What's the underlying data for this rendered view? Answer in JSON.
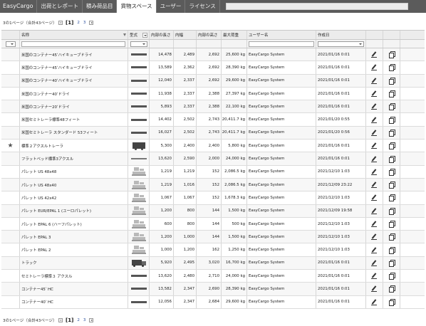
{
  "tabs": [
    {
      "label": "EasyCargo"
    },
    {
      "label": "出荷とレポート"
    },
    {
      "label": "積み荷品目"
    },
    {
      "label": "貨物スペース"
    },
    {
      "label": "ユーザー"
    },
    {
      "label": "ライセンス"
    }
  ],
  "pager": {
    "summary": "3の1ページ（合計43ページ）",
    "current": "[1]",
    "page2": "2",
    "page3": "3"
  },
  "columns": [
    "名称",
    "型式",
    "内部の長さ",
    "内幅",
    "内部の高さ",
    "最大荷重",
    "ユーザー名",
    "作成日"
  ],
  "rows": [
    {
      "name": "米国のコンテナー45ʹハイキューブドライ",
      "shape": "bar",
      "len": "14,478",
      "wid": "2,489",
      "hgt": "2,692",
      "load": "25,600 kg",
      "user": "EasyCargo System",
      "date": "2021/01/16 0:01",
      "fav": ""
    },
    {
      "name": "米国のコンテナー45ʹハイキューブドライ",
      "shape": "bar",
      "len": "13,589",
      "wid": "2,362",
      "hgt": "2,692",
      "load": "28,390 kg",
      "user": "EasyCargo System",
      "date": "2021/01/16 0:01",
      "fav": ""
    },
    {
      "name": "米国のコンテナー40ʹハイキューブドライ",
      "shape": "bar",
      "len": "12,040",
      "wid": "2,337",
      "hgt": "2,692",
      "load": "29,600 kg",
      "user": "EasyCargo System",
      "date": "2021/01/16 0:01",
      "fav": ""
    },
    {
      "name": "米国のコンテナー40ʹドライ",
      "shape": "bar",
      "len": "11,938",
      "wid": "2,337",
      "hgt": "2,388",
      "load": "27,397 kg",
      "user": "EasyCargo System",
      "date": "2021/01/16 0:01",
      "fav": ""
    },
    {
      "name": "米国のコンテナー20ʹドライ",
      "shape": "bar",
      "len": "5,893",
      "wid": "2,337",
      "hgt": "2,388",
      "load": "22,100 kg",
      "user": "EasyCargo System",
      "date": "2021/01/16 0:01",
      "fav": ""
    },
    {
      "name": "米国セミトレーラ標準48フィート",
      "shape": "bar",
      "len": "14,402",
      "wid": "2,502",
      "hgt": "2,743",
      "load": "20,411.7 kg",
      "user": "EasyCargo System",
      "date": "2021/01/20 0:55",
      "fav": ""
    },
    {
      "name": "米国セミトレーラ スタンダード 53フィート",
      "shape": "bar",
      "len": "16,027",
      "wid": "2,502",
      "hgt": "2,743",
      "load": "20,411.7 kg",
      "user": "EasyCargo System",
      "date": "2021/01/20 0:56",
      "fav": ""
    },
    {
      "name": "標準２アクスルトレーラ",
      "shape": "trailer",
      "len": "5,300",
      "wid": "2,400",
      "hgt": "2,400",
      "load": "5,800 kg",
      "user": "EasyCargo System",
      "date": "2021/01/16 0:01",
      "fav": "★"
    },
    {
      "name": "フラットベッド標準3アクスル",
      "shape": "thin",
      "len": "13,620",
      "wid": "2,590",
      "hgt": "2,000",
      "load": "24,000 kg",
      "user": "EasyCargo System",
      "date": "2021/01/16 0:01",
      "fav": ""
    },
    {
      "name": "パレット US 48x48",
      "shape": "pallet",
      "len": "1,219",
      "wid": "1,219",
      "hgt": "152",
      "load": "2,086.5 kg",
      "user": "EasyCargo System",
      "date": "2021/12/10 1:03",
      "fav": ""
    },
    {
      "name": "パレット US 48x40",
      "shape": "pallet",
      "len": "1,219",
      "wid": "1,016",
      "hgt": "152",
      "load": "2,086.5 kg",
      "user": "EasyCargo System",
      "date": "2021/12/09 23:22",
      "fav": ""
    },
    {
      "name": "パレット US 42x42",
      "shape": "pallet",
      "len": "1,067",
      "wid": "1,067",
      "hgt": "152",
      "load": "1,678.3 kg",
      "user": "EasyCargo System",
      "date": "2021/12/10 1:03",
      "fav": ""
    },
    {
      "name": "パレット EUR/EPAL 1 (ユーロパレット)",
      "shape": "pallet",
      "len": "1,200",
      "wid": "800",
      "hgt": "144",
      "load": "1,500 kg",
      "user": "EasyCargo System",
      "date": "2021/12/09 19:58",
      "fav": ""
    },
    {
      "name": "パレット EPAL 6 (ハーフパレット)",
      "shape": "pallet",
      "len": "600",
      "wid": "800",
      "hgt": "144",
      "load": "500 kg",
      "user": "EasyCargo System",
      "date": "2021/12/10 1:03",
      "fav": ""
    },
    {
      "name": "パレット EPAL 3",
      "shape": "pallet",
      "len": "1,200",
      "wid": "1,000",
      "hgt": "144",
      "load": "1,500 kg",
      "user": "EasyCargo System",
      "date": "2021/12/10 1:03",
      "fav": ""
    },
    {
      "name": "パレット EPAL 2",
      "shape": "pallet",
      "len": "1,000",
      "wid": "1,200",
      "hgt": "162",
      "load": "1,250 kg",
      "user": "EasyCargo System",
      "date": "2021/12/10 1:03",
      "fav": ""
    },
    {
      "name": "トラック",
      "shape": "truck",
      "len": "5,920",
      "wid": "2,495",
      "hgt": "3,020",
      "load": "16,700 kg",
      "user": "EasyCargo System",
      "date": "2021/01/16 0:01",
      "fav": ""
    },
    {
      "name": "セミトレーラ標準３ アクスル",
      "shape": "bar",
      "len": "13,620",
      "wid": "2,480",
      "hgt": "2,710",
      "load": "24,000 kg",
      "user": "EasyCargo System",
      "date": "2021/01/16 0:01",
      "fav": ""
    },
    {
      "name": "コンテナー45ʹ HC",
      "shape": "bar",
      "len": "13,582",
      "wid": "2,347",
      "hgt": "2,690",
      "load": "28,390 kg",
      "user": "EasyCargo System",
      "date": "2021/01/16 0:01",
      "fav": ""
    },
    {
      "name": "コンテナー40ʹ HC",
      "shape": "bar",
      "len": "12,056",
      "wid": "2,347",
      "hgt": "2,684",
      "load": "29,600 kg",
      "user": "EasyCargo System",
      "date": "2021/01/16 0:01",
      "fav": ""
    }
  ]
}
